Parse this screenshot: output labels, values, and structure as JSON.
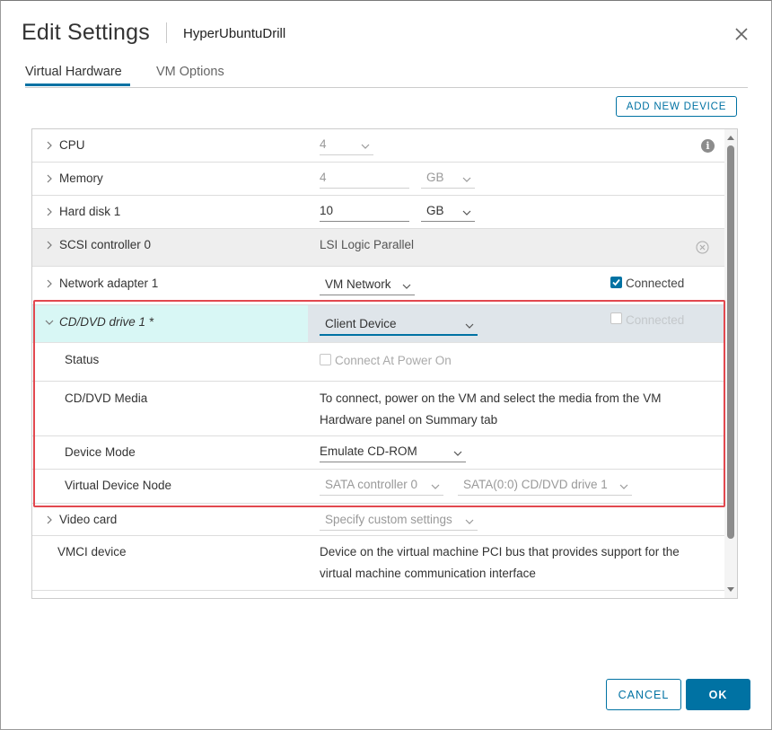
{
  "dialog": {
    "title": "Edit Settings",
    "vm_name": "HyperUbuntuDrill"
  },
  "tabs": [
    {
      "label": "Virtual Hardware",
      "active": true
    },
    {
      "label": "VM Options",
      "active": false
    }
  ],
  "toolbar": {
    "add_device_label": "ADD NEW DEVICE"
  },
  "hardware": {
    "cpu": {
      "label": "CPU",
      "value": "4"
    },
    "memory": {
      "label": "Memory",
      "value": "4",
      "unit": "GB"
    },
    "hard_disk": {
      "label": "Hard disk 1",
      "value": "10",
      "unit": "GB"
    },
    "scsi": {
      "label": "SCSI controller 0",
      "value": "LSI Logic Parallel"
    },
    "network": {
      "label": "Network adapter 1",
      "value": "VM Network",
      "connected_label": "Connected",
      "connected": true
    },
    "cddvd": {
      "label": "CD/DVD drive 1 *",
      "value": "Client Device",
      "connected_label": "Connected",
      "connected": false,
      "status": {
        "label": "Status",
        "checkbox_label": "Connect At Power On",
        "checked": false
      },
      "media": {
        "label": "CD/DVD Media",
        "text_line1": "To connect, power on the VM and select the media from the VM",
        "text_line2": "Hardware panel on Summary tab"
      },
      "device_mode": {
        "label": "Device Mode",
        "value": "Emulate CD-ROM"
      },
      "node": {
        "label": "Virtual Device Node",
        "controller": "SATA controller 0",
        "slot": "SATA(0:0) CD/DVD drive 1"
      }
    },
    "video": {
      "label": "Video card",
      "value": "Specify custom settings"
    },
    "vmci": {
      "label": "VMCI device",
      "text_line1": "Device on the virtual machine PCI bus that provides support for the",
      "text_line2": "virtual machine communication interface"
    }
  },
  "footer": {
    "cancel_label": "CANCEL",
    "ok_label": "OK"
  },
  "colors": {
    "accent": "#0072a3",
    "highlight_border": "#e2484f",
    "selected_row": "#d8f7f5"
  }
}
